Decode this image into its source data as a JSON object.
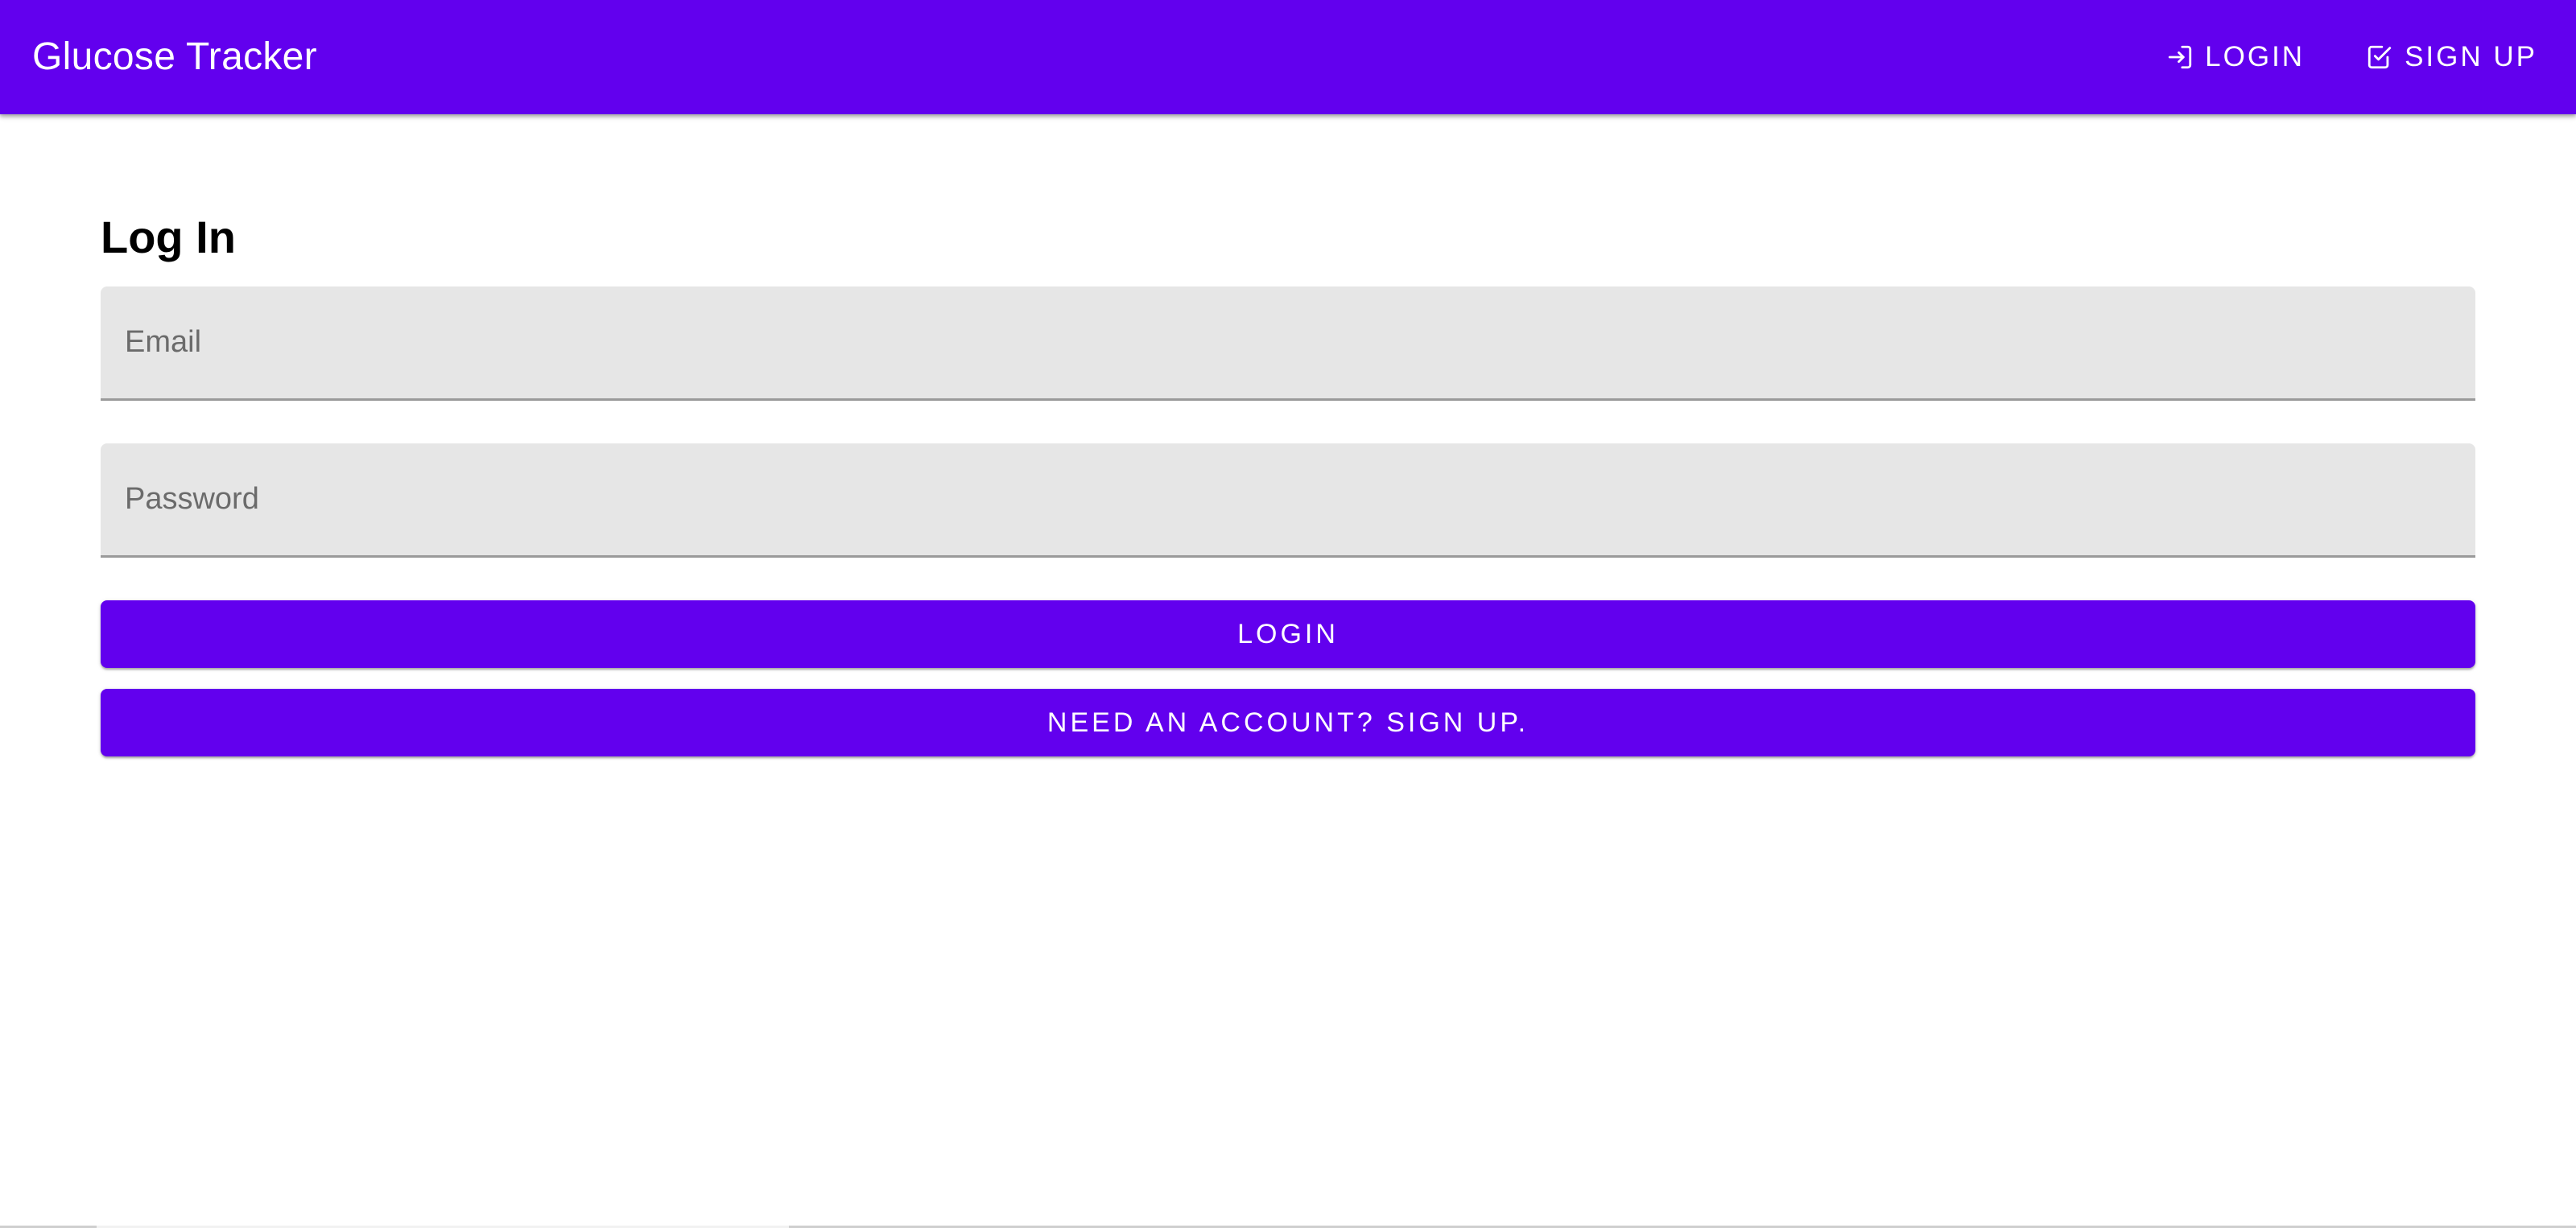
{
  "appbar": {
    "title": "Glucose Tracker",
    "nav": [
      {
        "label": "LOGIN",
        "icon": "login-icon"
      },
      {
        "label": "SIGN UP",
        "icon": "checkbox-icon"
      }
    ]
  },
  "main": {
    "heading": "Log In",
    "email_placeholder": "Email",
    "password_placeholder": "Password",
    "login_button": "LOGIN",
    "signup_button": "NEED AN ACCOUNT? SIGN UP."
  },
  "colors": {
    "primary": "#6200ee",
    "field_background": "#e6e6e6",
    "text": "#000000"
  }
}
